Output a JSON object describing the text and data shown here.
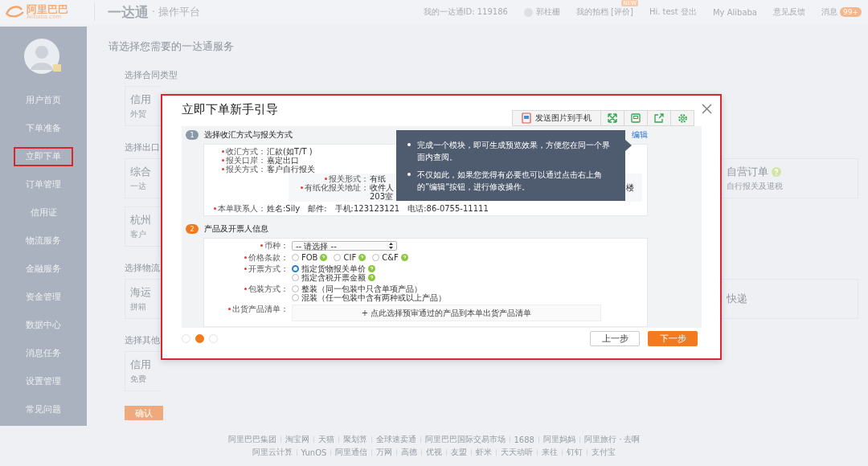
{
  "header": {
    "logo_text": "阿里巴巴",
    "logo_sub": "Alibaba.com",
    "product": "一达通",
    "subtitle": "· 操作平台",
    "links": [
      {
        "kind": "plain",
        "text": "我的一达通ID: 119186"
      },
      {
        "kind": "user",
        "text": "郭柱栅"
      },
      {
        "kind": "new",
        "text": "我的拍档 [评价]",
        "badge": "NEW"
      },
      {
        "kind": "plain",
        "text": "Hi. test 登出"
      },
      {
        "kind": "plain",
        "text": "My Alibaba"
      },
      {
        "kind": "plain",
        "text": "意见反馈"
      },
      {
        "kind": "count",
        "text": "消息",
        "badge": "99+"
      }
    ]
  },
  "sidebar": {
    "items": [
      {
        "label": "用户首页",
        "selected": false
      },
      {
        "label": "下单准备",
        "selected": false
      },
      {
        "label": "立即下单",
        "selected": true
      },
      {
        "label": "订单管理",
        "selected": false
      },
      {
        "label": "信用证",
        "selected": false
      },
      {
        "label": "物流服务",
        "selected": false
      },
      {
        "label": "金融服务",
        "selected": false
      },
      {
        "label": "资金管理",
        "selected": false
      },
      {
        "label": "数据中心",
        "selected": false
      },
      {
        "label": "消息任务",
        "selected": false
      },
      {
        "label": "设置管理",
        "selected": false
      },
      {
        "label": "常见问题",
        "selected": false
      }
    ]
  },
  "main": {
    "heading": "请选择您需要的一达通服务",
    "sections": [
      {
        "label": "选择合同类型",
        "rows": [
          {
            "left": {
              "title": "信用",
              "subtitle": "外贸"
            }
          }
        ]
      },
      {
        "label": "选择出口",
        "rows": [
          {
            "left": {
              "title": "综合",
              "subtitle": "一达"
            },
            "right": {
              "title": "自营订单",
              "help": true,
              "subtitle": "自行报关及退税"
            }
          },
          {
            "left": {
              "title": "杭州",
              "subtitle": "客户"
            }
          }
        ]
      },
      {
        "label": "选择物流",
        "rows": [
          {
            "left": {
              "title": "海运",
              "subtitle": "拼箱"
            },
            "right": {
              "title": "快递",
              "help": false
            }
          }
        ]
      },
      {
        "label": "选择其他",
        "rows": [
          {
            "left": {
              "title": "信用",
              "subtitle": "免费"
            }
          }
        ]
      }
    ],
    "confirm": "确认"
  },
  "footer": {
    "lines": [
      [
        "阿里巴巴集团",
        "淘宝网",
        "天猫",
        "聚划算",
        "全球速卖通",
        "阿里巴巴国际交易市场",
        "1688",
        "阿里妈妈",
        "阿里旅行 · 去啊"
      ],
      [
        "阿里云计算",
        "YunOS",
        "阿里通信",
        "万网",
        "高德",
        "优视",
        "友盟",
        "虾米",
        "天天动听",
        "来往",
        "钉钉",
        "支付宝"
      ]
    ]
  },
  "dialog": {
    "title": "立即下单新手引导",
    "send_button": "发送图片到手机",
    "step1": {
      "number": "1",
      "title": "选择收汇方式与报关方式",
      "active": false,
      "edit": "编辑",
      "rows": [
        {
          "label": "收汇方式：",
          "value": "汇款(如T/T )",
          "required": true
        },
        {
          "label": "报关口岸：",
          "value": "嘉定出口",
          "required": true
        },
        {
          "label": "报关方式：",
          "value": "客户自行报关",
          "required": true
        }
      ],
      "sub_rows": [
        {
          "label": "报关形式：",
          "value": "有纸",
          "required": true
        },
        {
          "label": "有纸化报关地址：",
          "value": "收件人",
          "extra": "203室",
          "tail": "楼",
          "required": true
        }
      ],
      "contact": {
        "label": "本单联系人：",
        "value": "姓名:Sily　邮件:　手机:123123121　电话:86-0755-11111",
        "required": true
      }
    },
    "tooltip": [
      "完成一个模块，即可生成预览效果，方便您在同一个界面内查阅。",
      "不仅如此，如果您觉得有必要也可以通过点击右上角的”编辑“按钮，进行修改操作。"
    ],
    "step2": {
      "number": "2",
      "title": "产品及开票人信息",
      "active": true,
      "fields": [
        {
          "kind": "select",
          "label": "币种：",
          "required": true,
          "placeholder": "-- 请选择 --"
        },
        {
          "kind": "radio-row",
          "label": "价格条款：",
          "required": true,
          "options": [
            {
              "text": "FOB",
              "checked": false,
              "help": true
            },
            {
              "text": "CIF",
              "checked": false,
              "help": true
            },
            {
              "text": "C&F",
              "checked": false,
              "help": true
            }
          ]
        },
        {
          "kind": "radio-stack",
          "label": "开票方式：",
          "required": true,
          "options": [
            {
              "text": "指定货物报关单价",
              "checked": true,
              "help": true
            },
            {
              "text": "指定含税开票金额",
              "checked": false,
              "help": true
            }
          ]
        },
        {
          "kind": "radio-stack",
          "label": "包装方式：",
          "required": true,
          "options": [
            {
              "text": "整装（同一包装中只含单项产品）",
              "checked": false,
              "help": false
            },
            {
              "text": "混装（任一包装中含有两种或以上产品）",
              "checked": false,
              "help": false
            }
          ]
        },
        {
          "kind": "picker",
          "label": "出货产品清单：",
          "required": true,
          "text": "+  点此选择预审通过的产品到本单出货产品清单"
        }
      ]
    },
    "pager": [
      {
        "selected": false
      },
      {
        "selected": true
      },
      {
        "selected": false
      }
    ],
    "prev": "上一步",
    "next": "下一步"
  }
}
